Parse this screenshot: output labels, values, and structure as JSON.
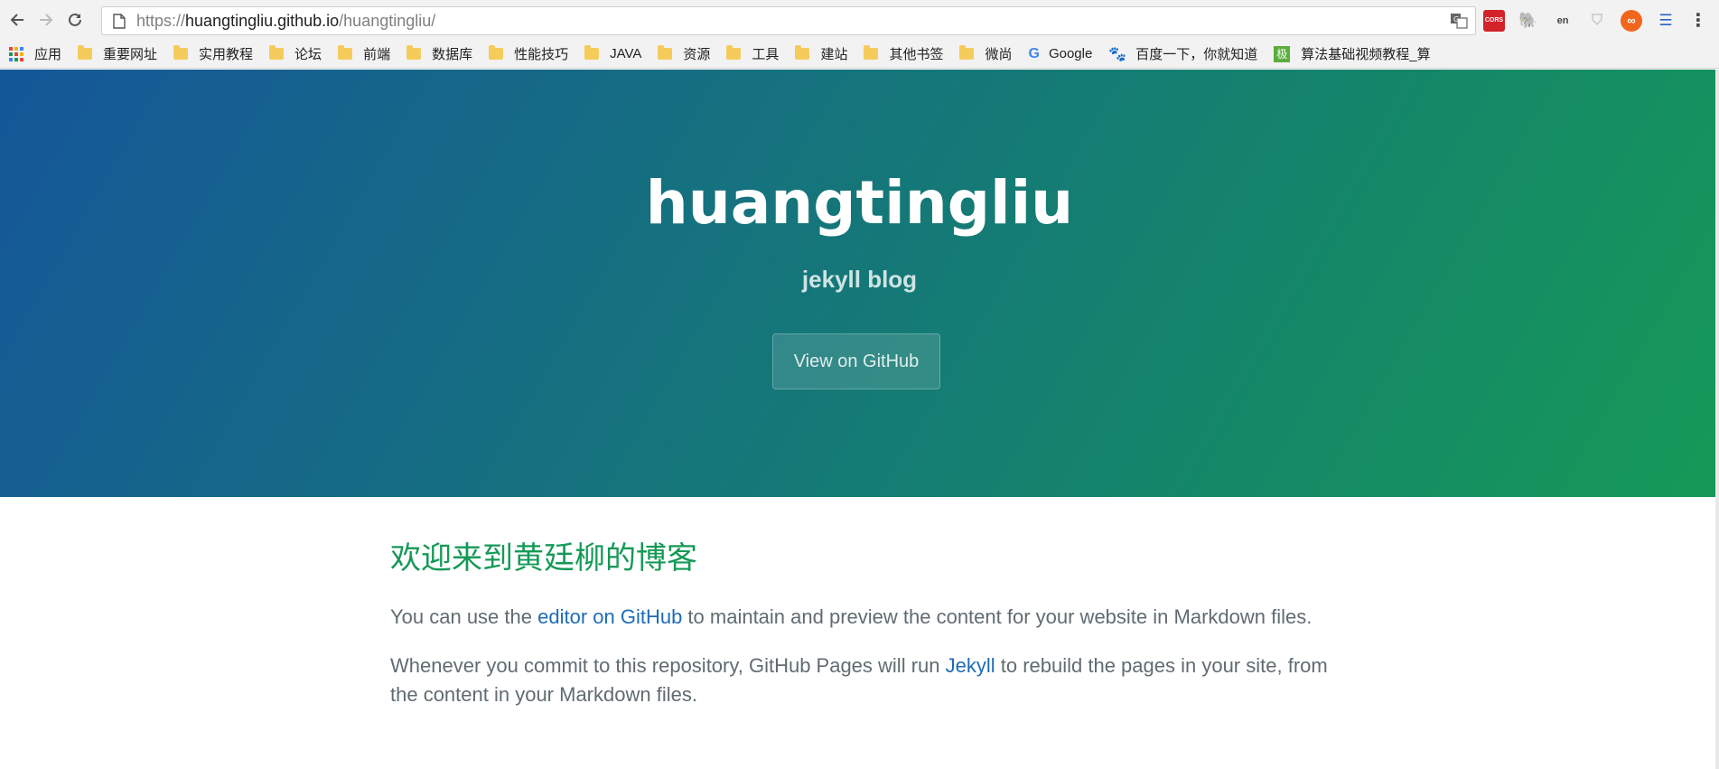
{
  "browser": {
    "url_scheme": "https://",
    "url_host": "huangtingliu.github.io",
    "url_path": "/huangtingliu/",
    "extensions": [
      "cors-icon",
      "evernote-icon",
      "en-icon",
      "shield-icon",
      "infinity-icon",
      "miao-icon"
    ],
    "cors_label": "CORS",
    "en_label": "en"
  },
  "bookmarks": {
    "apps": "应用",
    "folders": [
      "重要网址",
      "实用教程",
      "论坛",
      "前端",
      "数据库",
      "性能技巧",
      "JAVA",
      "资源",
      "工具",
      "建站",
      "其他书签",
      "微尚"
    ],
    "google": "Google",
    "baidu": "百度一下，你就知道",
    "algo_icon_text": "极",
    "algo": "算法基础视频教程_算"
  },
  "header": {
    "title": "huangtingliu",
    "tagline": "jekyll blog",
    "button": "View on GitHub",
    "gradient_from": "#155799",
    "gradient_to": "#159957"
  },
  "content": {
    "heading": "欢迎来到黄廷柳的博客",
    "p1_before": "You can use the ",
    "p1_link": "editor on GitHub",
    "p1_after": " to maintain and preview the content for your website in Markdown files.",
    "p2_before": "Whenever you commit to this repository, GitHub Pages will run ",
    "p2_link": "Jekyll",
    "p2_after": " to rebuild the pages in your site, from the content in your Markdown files."
  }
}
